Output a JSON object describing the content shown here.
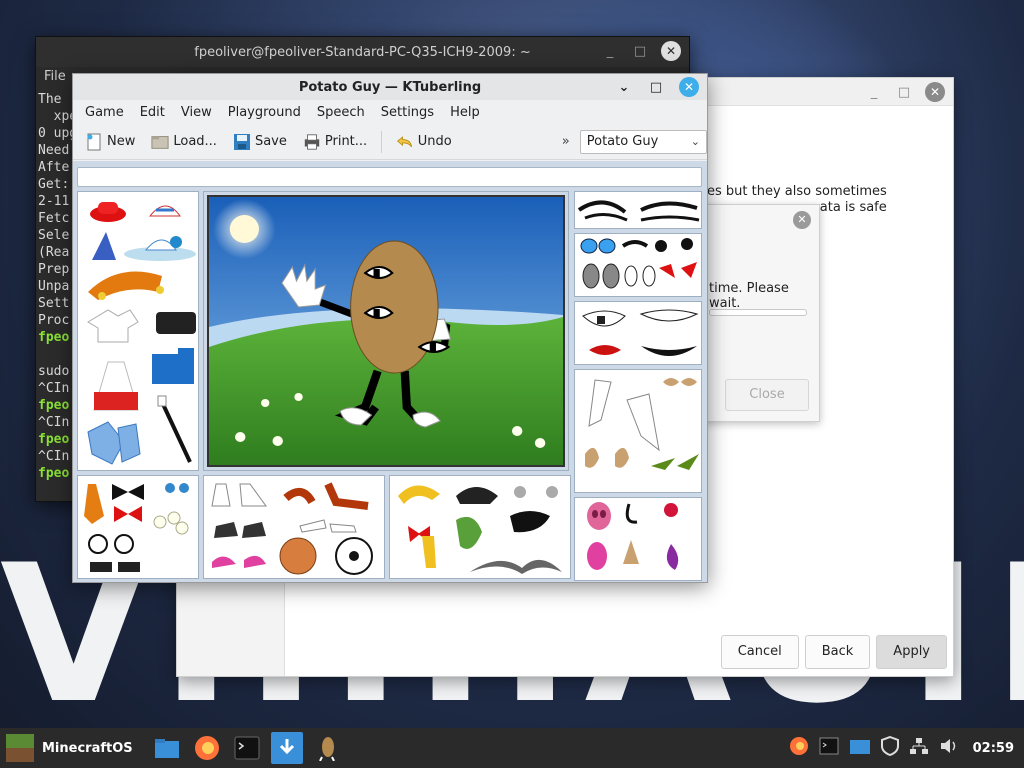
{
  "wallpaper": {
    "big_text": "VIIIIIAUIK"
  },
  "terminal": {
    "title": "fpeoliver@fpeoliver-Standard-PC-Q35-ICH9-2009: ~",
    "menu_file": "File",
    "lines": [
      "The",
      "  xpe",
      "0 upg",
      "Need",
      "Afte",
      "Get:",
      "2-11",
      "Fetc",
      "Sele",
      "(Rea",
      "Prep",
      "Unpa",
      "Sett",
      "Proc"
    ],
    "prompt_1": "fpeo",
    "blank": "",
    "sudo": "sudo",
    "cint_1": "^CIn",
    "prompt_2": "fpeo",
    "cint_2": "^CIn",
    "prompt_3": "fpeo",
    "cint_3": "^CIn",
    "prompt_4": "fpeo"
  },
  "wizard": {
    "desc_line1": "es but they also sometimes",
    "desc_line2": "ata is safe",
    "buttons": {
      "cancel": "Cancel",
      "back": "Back",
      "apply": "Apply"
    }
  },
  "progress_dialog": {
    "message": "time. Please wait.",
    "close_label": "Close",
    "progress": 0
  },
  "ktuberling": {
    "title": "Potato Guy — KTuberling",
    "menu": [
      "Game",
      "Edit",
      "View",
      "Playground",
      "Speech",
      "Settings",
      "Help"
    ],
    "toolbar": {
      "new": "New",
      "load": "Load...",
      "save": "Save",
      "print": "Print...",
      "undo": "Undo",
      "more": "»"
    },
    "playground_select": "Potato Guy"
  },
  "taskbar": {
    "os_label": "MinecraftOS",
    "clock": "02:59"
  }
}
